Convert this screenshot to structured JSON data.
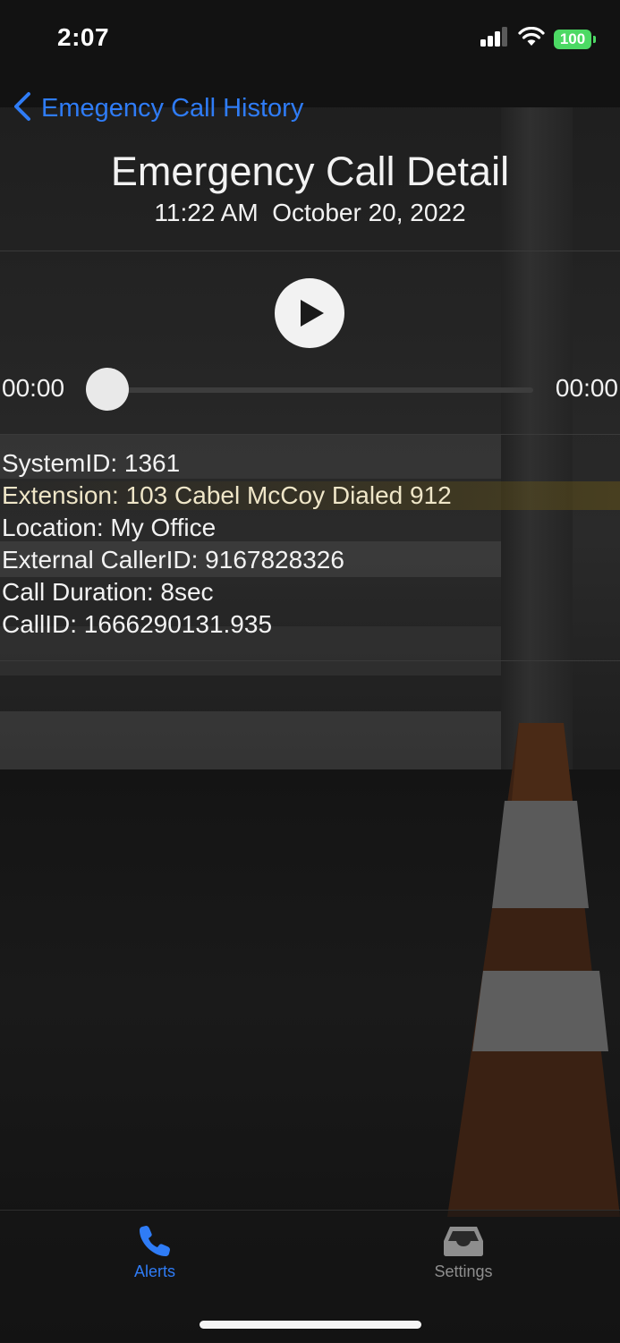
{
  "status_bar": {
    "time": "2:07",
    "battery": "100",
    "icons": [
      "cellular-signal-icon",
      "wifi-icon",
      "battery-icon"
    ]
  },
  "nav": {
    "back_label": "Emegency Call History",
    "back_icon": "chevron-left-icon"
  },
  "header": {
    "title": "Emergency Call Detail",
    "datetime": "11:22 AM  October 20, 2022"
  },
  "player": {
    "play_icon": "play-icon",
    "elapsed": "00:00",
    "duration": "00:00",
    "progress": 0
  },
  "details": {
    "system_id": "SystemID: 1361",
    "extension": "Extension: 103 Cabel McCoy Dialed 912",
    "location": "Location: My Office",
    "external_caller_id": "External CallerID: 9167828326",
    "call_duration": "Call Duration: 8sec",
    "call_id": "CallID: 1666290131.935"
  },
  "tabbar": {
    "tabs": [
      {
        "label": "Alerts",
        "icon": "phone-icon",
        "active": true
      },
      {
        "label": "Settings",
        "icon": "tray-icon",
        "active": false
      }
    ]
  },
  "colors": {
    "accent": "#2f7cf6",
    "text": "#f2f2f2",
    "battery": "#4cd964",
    "inactive_tab": "#8e8e8e"
  }
}
